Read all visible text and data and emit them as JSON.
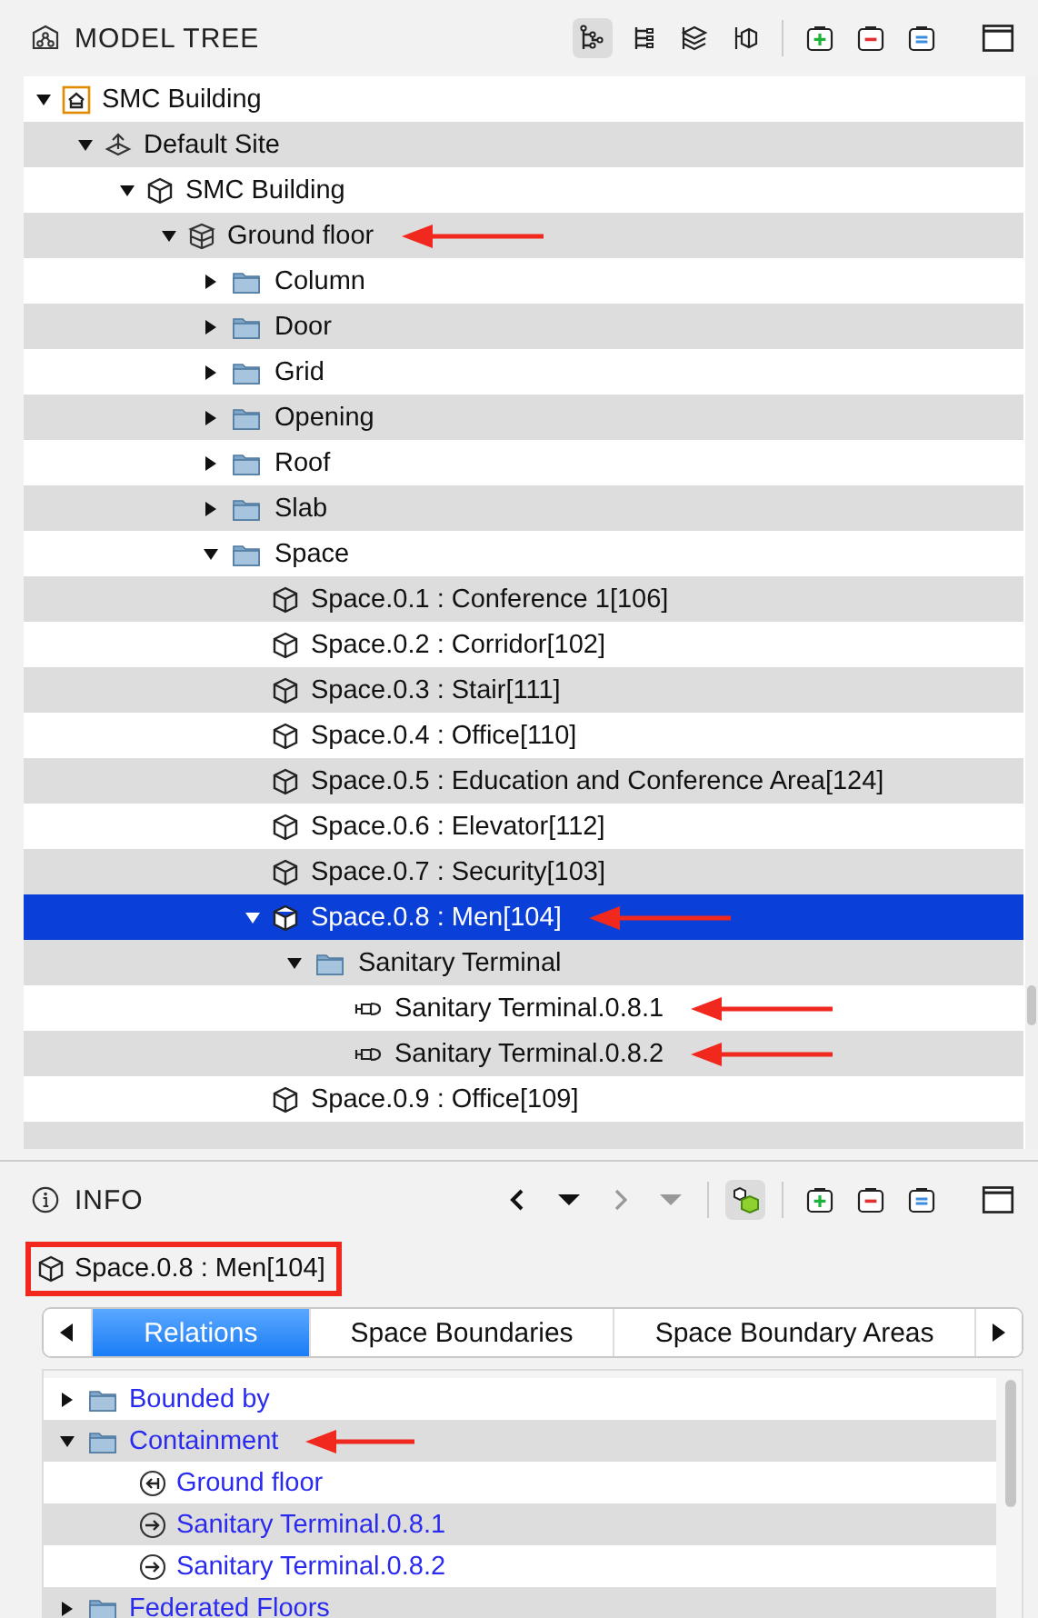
{
  "model_tree": {
    "title": "MODEL TREE",
    "view_buttons": [
      {
        "kind": "hierarchy",
        "selected": true
      },
      {
        "kind": "flat",
        "selected": false
      },
      {
        "kind": "layers",
        "selected": false
      },
      {
        "kind": "spatial",
        "selected": false
      }
    ],
    "actions": [
      {
        "kind": "add"
      },
      {
        "kind": "remove"
      },
      {
        "kind": "equal"
      }
    ],
    "nodes": [
      {
        "label": "SMC Building",
        "kind": "project",
        "expanded": true,
        "selected": false,
        "children": [
          {
            "label": "Default Site",
            "kind": "site",
            "expanded": true,
            "selected": false,
            "children": [
              {
                "label": "SMC Building",
                "kind": "building",
                "expanded": true,
                "selected": false,
                "children": [
                  {
                    "label": "Ground floor",
                    "kind": "storey",
                    "expanded": true,
                    "selected": false,
                    "arrow": true,
                    "children": [
                      {
                        "label": "Column",
                        "kind": "folder",
                        "expanded": false,
                        "selected": false
                      },
                      {
                        "label": "Door",
                        "kind": "folder",
                        "expanded": false,
                        "selected": false
                      },
                      {
                        "label": "Grid",
                        "kind": "folder",
                        "expanded": false,
                        "selected": false
                      },
                      {
                        "label": "Opening",
                        "kind": "folder",
                        "expanded": false,
                        "selected": false
                      },
                      {
                        "label": "Roof",
                        "kind": "folder",
                        "expanded": false,
                        "selected": false
                      },
                      {
                        "label": "Slab",
                        "kind": "folder",
                        "expanded": false,
                        "selected": false
                      },
                      {
                        "label": "Space",
                        "kind": "folder",
                        "expanded": true,
                        "selected": false,
                        "children": [
                          {
                            "label": "Space.0.1 : Conference 1[106]",
                            "kind": "space",
                            "selected": false
                          },
                          {
                            "label": "Space.0.2 : Corridor[102]",
                            "kind": "space",
                            "selected": false
                          },
                          {
                            "label": "Space.0.3 : Stair[111]",
                            "kind": "space",
                            "selected": false
                          },
                          {
                            "label": "Space.0.4 : Office[110]",
                            "kind": "space",
                            "selected": false
                          },
                          {
                            "label": "Space.0.5 : Education and Conference Area[124]",
                            "kind": "space",
                            "selected": false
                          },
                          {
                            "label": "Space.0.6 : Elevator[112]",
                            "kind": "space",
                            "selected": false
                          },
                          {
                            "label": "Space.0.7 : Security[103]",
                            "kind": "space",
                            "selected": false
                          },
                          {
                            "label": "Space.0.8 : Men[104]",
                            "kind": "space",
                            "expanded": true,
                            "selected": true,
                            "arrow": true,
                            "children": [
                              {
                                "label": "Sanitary Terminal",
                                "kind": "folder",
                                "expanded": true,
                                "selected": false,
                                "children": [
                                  {
                                    "label": "Sanitary Terminal.0.8.1",
                                    "kind": "terminal",
                                    "selected": false,
                                    "arrow": true
                                  },
                                  {
                                    "label": "Sanitary Terminal.0.8.2",
                                    "kind": "terminal",
                                    "selected": false,
                                    "arrow": true
                                  }
                                ]
                              }
                            ]
                          },
                          {
                            "label": "Space.0.9 : Office[109]",
                            "kind": "space",
                            "selected": false
                          }
                        ]
                      }
                    ]
                  }
                ]
              }
            ]
          }
        ]
      }
    ]
  },
  "info": {
    "title": "INFO",
    "nav": [
      {
        "kind": "back",
        "disabled": false
      },
      {
        "kind": "menu",
        "disabled": false
      },
      {
        "kind": "forward",
        "disabled": true
      },
      {
        "kind": "menu",
        "disabled": true
      }
    ],
    "toggle": {
      "selected": true
    },
    "actions": [
      {
        "kind": "add"
      },
      {
        "kind": "remove"
      },
      {
        "kind": "equal"
      }
    ],
    "selection": {
      "label": "Space.0.8 : Men[104]",
      "kind": "space",
      "highlighted": true
    },
    "tabs": [
      {
        "label": "Relations",
        "selected": true
      },
      {
        "label": "Space Boundaries",
        "selected": false
      },
      {
        "label": "Space Boundary Areas",
        "selected": false
      }
    ],
    "relations": [
      {
        "label": "Bounded by",
        "kind": "folder",
        "expanded": false
      },
      {
        "label": "Containment",
        "kind": "folder",
        "expanded": true,
        "arrow": true,
        "children": [
          {
            "label": "Ground floor",
            "kind": "container"
          },
          {
            "label": "Sanitary Terminal.0.8.1",
            "kind": "contained"
          },
          {
            "label": "Sanitary Terminal.0.8.2",
            "kind": "contained"
          }
        ]
      },
      {
        "label": "Federated Floors",
        "kind": "folder",
        "expanded": false
      }
    ]
  }
}
